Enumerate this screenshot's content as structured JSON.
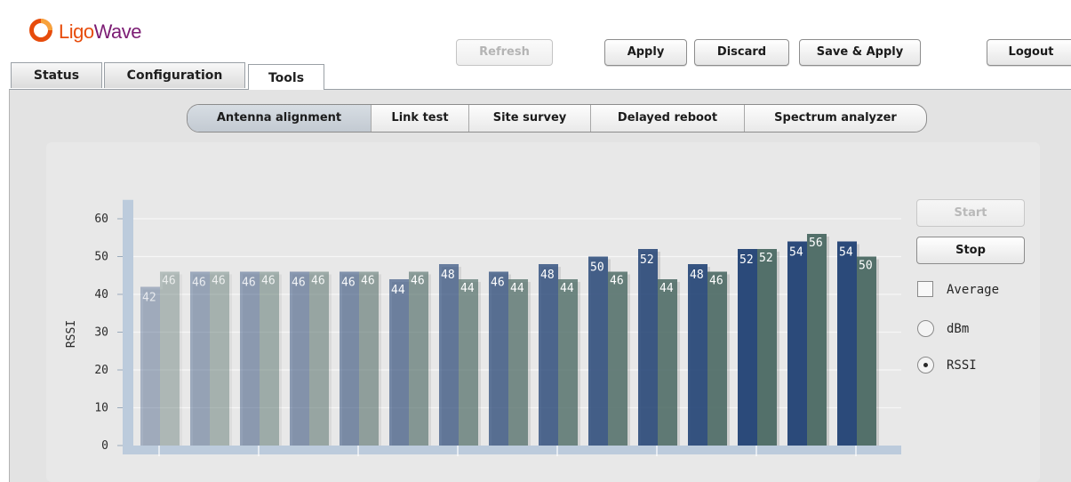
{
  "brand": {
    "logo_part1": "Ligo",
    "logo_part2": "Wave",
    "color_orange": "#e74c0c",
    "color_purple": "#7c1d74"
  },
  "main_tabs": [
    {
      "label": "Status",
      "active": false
    },
    {
      "label": "Configuration",
      "active": false
    },
    {
      "label": "Tools",
      "active": true
    }
  ],
  "toolbar": {
    "refresh_label": "Refresh",
    "apply_label": "Apply",
    "discard_label": "Discard",
    "save_apply_label": "Save & Apply",
    "logout_label": "Logout"
  },
  "tool_tabs": [
    {
      "label": "Antenna alignment",
      "active": true
    },
    {
      "label": "Link test",
      "active": false
    },
    {
      "label": "Site survey",
      "active": false
    },
    {
      "label": "Delayed reboot",
      "active": false
    },
    {
      "label": "Spectrum analyzer",
      "active": false
    }
  ],
  "controls": {
    "start_label": "Start",
    "stop_label": "Stop",
    "average_label": "Average",
    "average_checked": false,
    "dbm_label": "dBm",
    "rssi_label": "RSSI",
    "selected_unit": "RSSI"
  },
  "chart_data": {
    "type": "bar",
    "ylabel": "RSSI",
    "ylim": [
      0,
      65
    ],
    "yticks": [
      0,
      10,
      20,
      30,
      40,
      50,
      60
    ],
    "grid": true,
    "series": [
      {
        "values": [
          42,
          46,
          46,
          46,
          46,
          44,
          48,
          46,
          48,
          50,
          52,
          48,
          52,
          54,
          54
        ],
        "color": "#2b4a7a"
      },
      {
        "values": [
          46,
          46,
          46,
          46,
          46,
          46,
          44,
          44,
          44,
          46,
          44,
          46,
          52,
          56,
          50
        ],
        "color": "#53706a"
      }
    ],
    "fade_opacity": [
      0.35,
      0.4,
      0.45,
      0.5,
      0.55,
      0.62,
      0.68,
      0.74,
      0.8,
      0.86,
      0.9,
      0.94,
      1,
      1,
      1
    ]
  }
}
